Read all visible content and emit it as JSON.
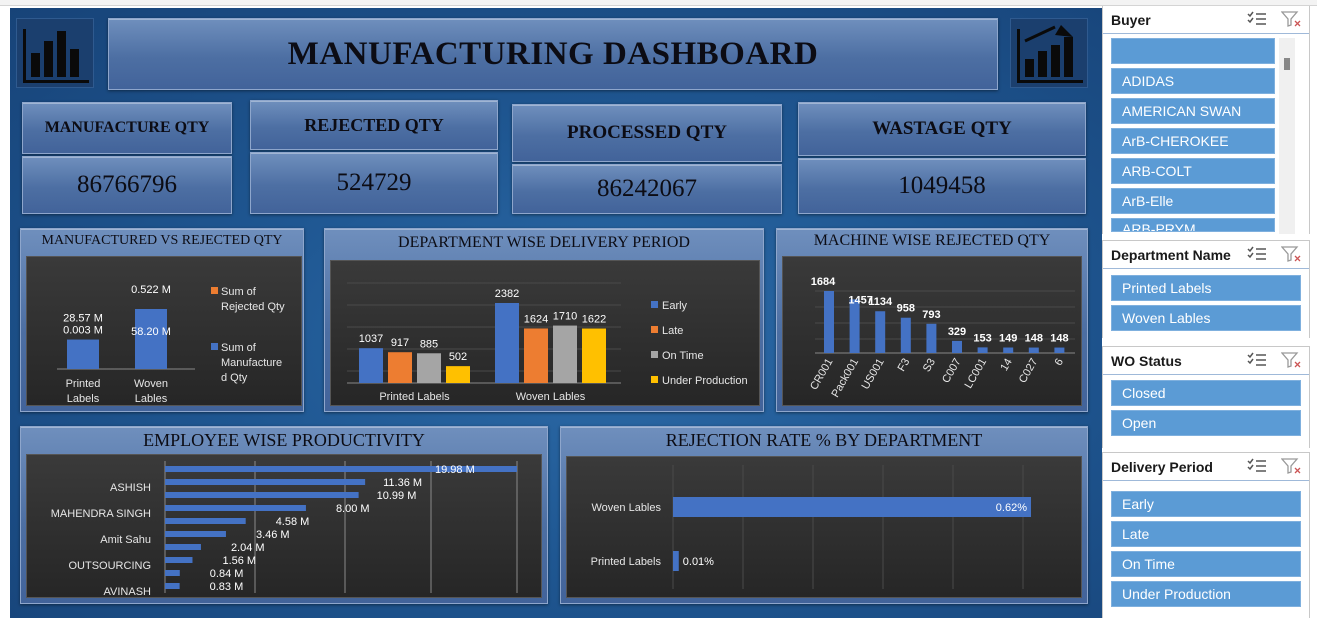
{
  "dashboard": {
    "title": "MANUFACTURING DASHBOARD",
    "kpis": [
      {
        "label": "MANUFACTURE QTY",
        "value": "86766796"
      },
      {
        "label": "REJECTED QTY",
        "value": "524729"
      },
      {
        "label": "PROCESSED QTY",
        "value": "86242067"
      },
      {
        "label": "WASTAGE QTY",
        "value": "1049458"
      }
    ]
  },
  "charts": {
    "mvr": {
      "title": "MANUFACTURED VS REJECTED QTY",
      "categories": [
        "Printed\nLabels",
        "Woven\nLables"
      ],
      "legend": [
        "Sum of Rejected Qty",
        "Sum of Manufactured Qty"
      ],
      "rejected_labels": [
        "0.003 M",
        "0.522 M"
      ],
      "manufactured_labels": [
        "28.57 M",
        "58.20 M"
      ],
      "colors": {
        "rejected": "#ed7d31",
        "manufactured": "#4472c4"
      }
    },
    "dept": {
      "title": "DEPARTMENT WISE DELIVERY PERIOD",
      "categories": [
        "Printed Labels",
        "Woven Lables"
      ],
      "series": [
        {
          "name": "Early",
          "values": [
            1037,
            2382
          ],
          "color": "#4472c4"
        },
        {
          "name": "Late",
          "values": [
            917,
            1624
          ],
          "color": "#ed7d31"
        },
        {
          "name": "On Time",
          "values": [
            885,
            1710
          ],
          "color": "#a5a5a5"
        },
        {
          "name": "Under Production",
          "values": [
            502,
            1622
          ],
          "color": "#ffc000"
        }
      ]
    },
    "machine": {
      "title": "MACHINE WISE REJECTED QTY",
      "categories": [
        "CR001",
        "Pack001",
        "US001",
        "F3",
        "S3",
        "C007",
        "LC001",
        "14",
        "C027",
        "6"
      ],
      "values": [
        1684,
        1457,
        1134,
        958,
        793,
        329,
        153,
        149,
        148,
        148
      ]
    },
    "employee": {
      "title": "EMPLOYEE WISE PRODUCTIVITY",
      "labels": [
        "ASHISH",
        "MAHENDRA SINGH",
        "Amit Sahu",
        "OUTSOURCING",
        "AVINASH"
      ],
      "values": [
        19.98,
        11.36,
        10.99,
        8.0,
        4.58,
        3.46,
        2.04,
        1.56,
        0.84,
        0.83
      ],
      "value_labels": [
        "19.98 M",
        "11.36 M",
        "10.99 M",
        "8.00 M",
        "4.58 M",
        "3.46 M",
        "2.04 M",
        "1.56 M",
        "0.84 M",
        "0.83 M"
      ]
    },
    "rejection": {
      "title": "REJECTION RATE % BY DEPARTMENT",
      "categories": [
        "Woven Lables",
        "Printed Labels"
      ],
      "values": [
        0.62,
        0.01
      ],
      "value_labels": [
        "0.62%",
        "0.01%"
      ]
    }
  },
  "slicers": {
    "buyer": {
      "title": "Buyer",
      "items": [
        "",
        "ADIDAS",
        "AMERICAN SWAN",
        "ArB-CHEROKEE",
        "ARB-COLT",
        "ArB-Elle",
        "ARB-PRYM"
      ]
    },
    "department": {
      "title": "Department Name",
      "items": [
        "Printed Labels",
        "Woven Lables"
      ]
    },
    "wo_status": {
      "title": "WO Status",
      "items": [
        "Closed",
        "Open"
      ]
    },
    "delivery": {
      "title": "Delivery Period",
      "items": [
        "Early",
        "Late",
        "On Time",
        "Under Production"
      ]
    }
  },
  "icons": {
    "multiselect": "multi-select-icon",
    "clear_filter": "clear-filter-icon",
    "bar_chart": "bar-chart-icon",
    "growth_chart": "growth-chart-icon"
  }
}
